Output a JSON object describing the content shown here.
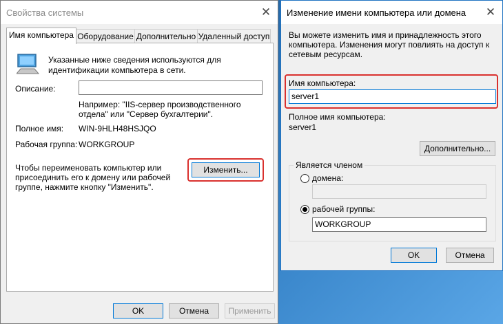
{
  "sys": {
    "title": "Свойства системы",
    "tabs": [
      "Имя компьютера",
      "Оборудование",
      "Дополнительно",
      "Удаленный доступ"
    ],
    "info": "Указанные ниже сведения используются для идентификации компьютера в сети.",
    "desc_label": "Описание:",
    "desc_value": "",
    "example": "Например: \"IIS-сервер производственного отдела\" или \"Сервер бухгалтерии\".",
    "fullname_label": "Полное имя:",
    "fullname_value": "WIN-9HLH48HSJQO",
    "workgroup_label": "Рабочая группа:",
    "workgroup_value": "WORKGROUP",
    "rename_text": "Чтобы переименовать компьютер или присоединить его к домену или рабочей группе, нажмите кнопку \"Изменить\".",
    "change_button": "Изменить...",
    "ok": "OK",
    "cancel": "Отмена",
    "apply": "Применить"
  },
  "rename": {
    "title": "Изменение имени компьютера или домена",
    "intro": "Вы можете изменить имя и принадлежность этого компьютера. Изменения могут повлиять на доступ к сетевым ресурсам.",
    "name_label": "Имя компьютера:",
    "name_value": "server1",
    "fullname_label": "Полное имя компьютера:",
    "fullname_value": "server1",
    "more_button": "Дополнительно...",
    "member_group_label": "Является членом",
    "domain_label": "домена:",
    "domain_value": "",
    "workgroup_label": "рабочей группы:",
    "workgroup_value": "WORKGROUP",
    "selected_member": "workgroup",
    "ok": "OK",
    "cancel": "Отмена"
  },
  "colors": {
    "highlight": "#d9302d",
    "focus_border": "#0078d7"
  }
}
